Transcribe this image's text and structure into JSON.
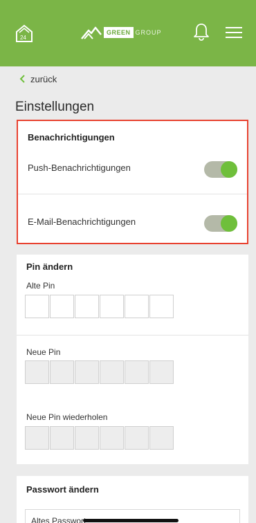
{
  "header": {
    "app_icon": "home-24-icon",
    "brand_word_1": "GREEN",
    "brand_word_2": "GROUP",
    "icons": [
      "bell-icon",
      "hamburger-menu-icon"
    ],
    "bg_color": "#7bb547"
  },
  "nav": {
    "back_label": "zurück",
    "back_icon": "chevron-left-icon"
  },
  "page": {
    "title": "Einstellungen"
  },
  "notifications": {
    "title": "Benachrichtigungen",
    "items": [
      {
        "label": "Push-Benachrichtigungen",
        "enabled": true
      },
      {
        "label": "E-Mail-Benachrichtigungen",
        "enabled": true
      }
    ],
    "highlight_color": "#e8412f"
  },
  "pin": {
    "title": "Pin ändern",
    "old_label": "Alte Pin",
    "new_label": "Neue Pin",
    "repeat_label": "Neue Pin wiederholen",
    "digits": 6
  },
  "password": {
    "title": "Passwort ändern",
    "old_placeholder": "Altes Passwort"
  },
  "colors": {
    "accent": "#6fbf3b",
    "toggle_track": "#b4b9a8"
  }
}
